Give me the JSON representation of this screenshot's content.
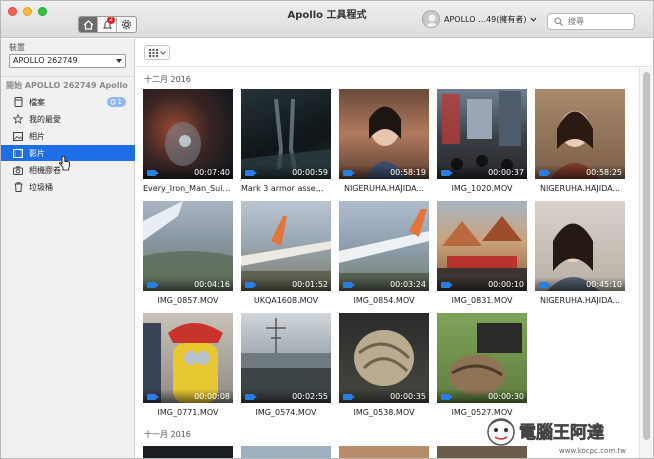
{
  "window": {
    "title": "Apollo 工具程式"
  },
  "toolbar": {
    "notification_count": "2"
  },
  "user": {
    "name": "APOLLO …49(擁有者)"
  },
  "search": {
    "placeholder": "搜尋"
  },
  "sidebar": {
    "device_caption": "裝置",
    "device_selected": "APOLLO 262749",
    "section_title": "開始 APOLLO 262749 Apollo",
    "items": [
      {
        "label": "檔案",
        "icon": "file-icon",
        "count": "1"
      },
      {
        "label": "我的最愛",
        "icon": "star-icon"
      },
      {
        "label": "相片",
        "icon": "photo-icon"
      },
      {
        "label": "影片",
        "icon": "video-icon",
        "selected": true
      },
      {
        "label": "相機膠卷",
        "icon": "camera-icon"
      },
      {
        "label": "垃圾桶",
        "icon": "trash-icon"
      }
    ]
  },
  "main": {
    "month_1": "十二月 2016",
    "month_2": "十一月 2016",
    "videos": [
      {
        "name": "Every_Iron_Man_Suit...",
        "duration": "00:07:40"
      },
      {
        "name": "Mark 3 armor assem...",
        "duration": "00:00:59"
      },
      {
        "name": "NIGERUHA.HAJIDA...",
        "duration": "00:58:19"
      },
      {
        "name": "IMG_1020.MOV",
        "duration": "00:00:37"
      },
      {
        "name": "NIGERUHA.HAJIDA...",
        "duration": "00:58:25"
      },
      {
        "name": "IMG_0857.MOV",
        "duration": "00:04:16"
      },
      {
        "name": "UKQA1608.MOV",
        "duration": "00:01:52"
      },
      {
        "name": "IMG_0854.MOV",
        "duration": "00:03:24"
      },
      {
        "name": "IMG_0831.MOV",
        "duration": "00:00:10"
      },
      {
        "name": "NIGERUHA.HAJIDA...",
        "duration": "00:45:10"
      },
      {
        "name": "IMG_0771.MOV",
        "duration": "00:00:08"
      },
      {
        "name": "IMG_0574.MOV",
        "duration": "00:02:55"
      },
      {
        "name": "IMG_0538.MOV",
        "duration": "00:00:35"
      },
      {
        "name": "IMG_0527.MOV",
        "duration": "00:00:30"
      }
    ]
  },
  "colors": {
    "selection": "#1e6ee8",
    "video_badge": "#2a7de1",
    "notification": "#e02424"
  },
  "watermark": {
    "text": "電腦王阿達",
    "url": "www.kocpc.com.tw"
  }
}
